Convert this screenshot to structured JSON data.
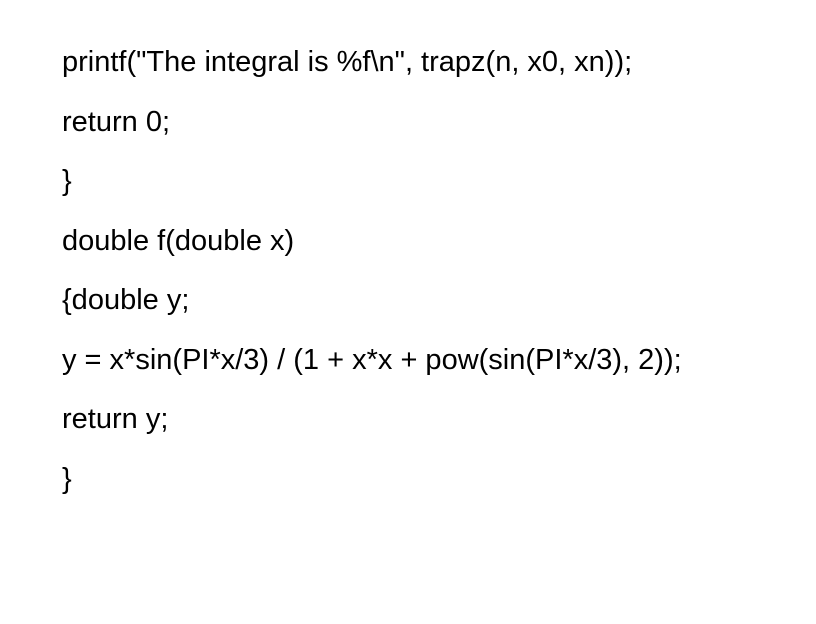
{
  "code": {
    "lines": [
      "printf(\"The integral is %f\\n\", trapz(n, x0, xn));",
      "return 0;",
      "}",
      "double f(double x)",
      "{double y;",
      "y = x*sin(PI*x/3) / (1 + x*x + pow(sin(PI*x/3), 2));",
      "return y;",
      "}"
    ]
  }
}
